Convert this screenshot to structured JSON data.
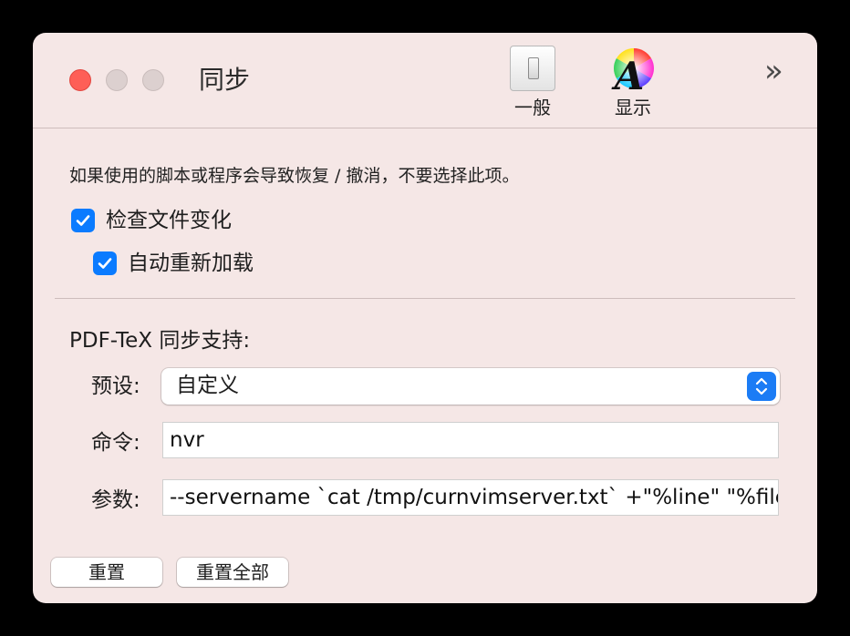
{
  "window": {
    "title": "同步",
    "accent_color": "#0a7bff",
    "background_color": "#f5e7e6"
  },
  "toolbar": {
    "items": [
      {
        "label": "一般",
        "icon": "toggle-switch-icon"
      },
      {
        "label": "显示",
        "icon": "font-color-wheel-icon"
      }
    ],
    "overflow_icon": "double-chevron-right-icon",
    "overflow_glyph": "»"
  },
  "sync": {
    "hint": "如果使用的脚本或程序会导致恢复 / 撤消，不要选择此项。",
    "check_file_changes": {
      "label": "检查文件变化",
      "checked": true
    },
    "auto_reload": {
      "label": "自动重新加载",
      "checked": true
    }
  },
  "pdf_tex": {
    "section_title": "PDF-TeX 同步支持:",
    "preset": {
      "label": "预设:",
      "value": "自定义"
    },
    "command": {
      "label": "命令:",
      "value": "nvr"
    },
    "arguments": {
      "label": "参数:",
      "value": "--servername `cat /tmp/curnvimserver.txt` +\"%line\" \"%file\""
    }
  },
  "buttons": {
    "reset": "重置",
    "reset_all": "重置全部"
  }
}
